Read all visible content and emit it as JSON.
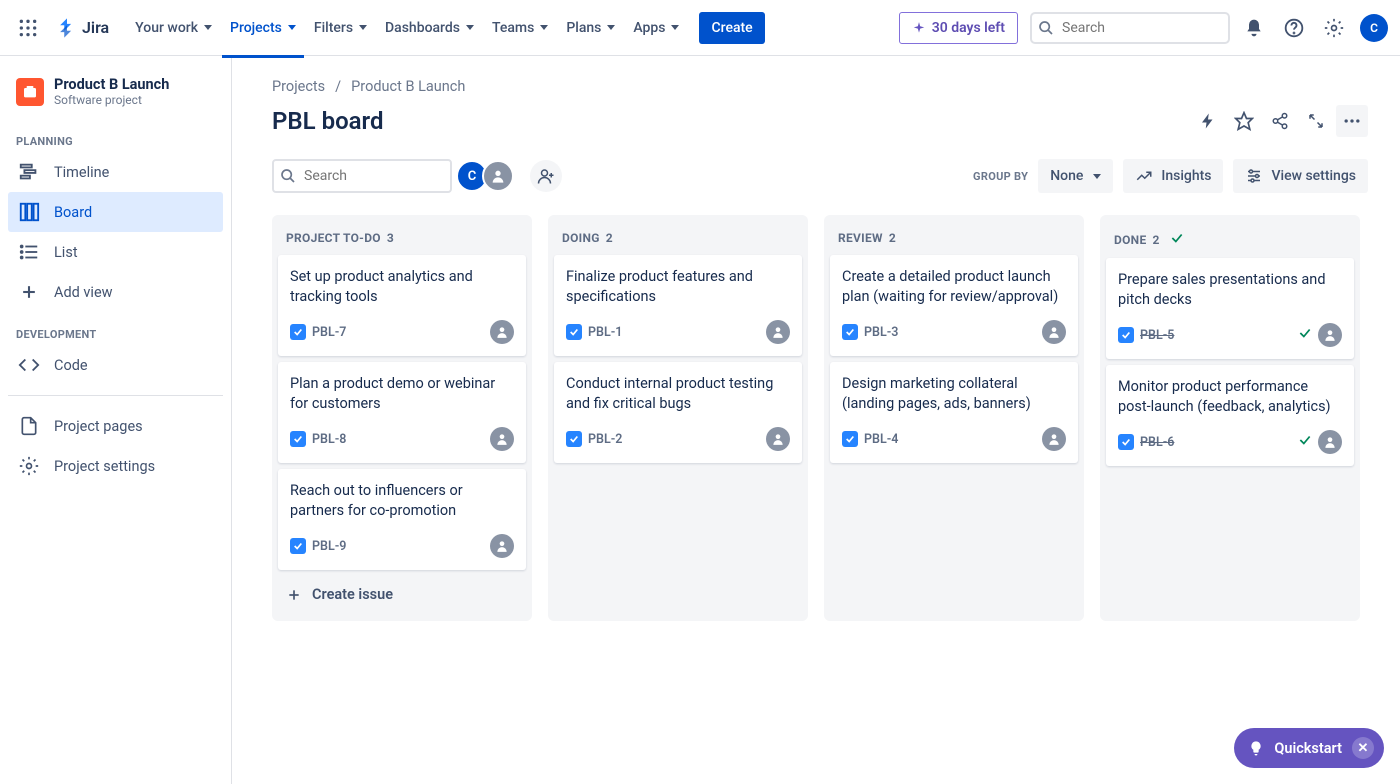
{
  "topnav": {
    "logo": "Jira",
    "items": [
      {
        "label": "Your work",
        "active": false
      },
      {
        "label": "Projects",
        "active": true
      },
      {
        "label": "Filters",
        "active": false
      },
      {
        "label": "Dashboards",
        "active": false
      },
      {
        "label": "Teams",
        "active": false
      },
      {
        "label": "Plans",
        "active": false
      },
      {
        "label": "Apps",
        "active": false
      }
    ],
    "create": "Create",
    "trial": "30 days left",
    "search_placeholder": "Search",
    "avatar_initial": "C"
  },
  "sidebar": {
    "project": {
      "name": "Product B Launch",
      "type": "Software project"
    },
    "sections": {
      "planning": "PLANNING",
      "development": "DEVELOPMENT"
    },
    "items": {
      "timeline": "Timeline",
      "board": "Board",
      "list": "List",
      "add_view": "Add view",
      "code": "Code",
      "project_pages": "Project pages",
      "project_settings": "Project settings"
    }
  },
  "breadcrumb": {
    "root": "Projects",
    "project": "Product B Launch"
  },
  "page": {
    "title": "PBL board",
    "search_placeholder": "Search",
    "group_by_label": "GROUP BY",
    "group_by_value": "None",
    "insights": "Insights",
    "view_settings": "View settings",
    "create_issue": "Create issue",
    "avatar_initial": "C"
  },
  "columns": [
    {
      "name": "PROJECT TO-DO",
      "count": "3",
      "done": false,
      "cards": [
        {
          "title": "Set up product analytics and tracking tools",
          "key": "PBL-7",
          "struck": false,
          "done": false
        },
        {
          "title": "Plan a product demo or webinar for customers",
          "key": "PBL-8",
          "struck": false,
          "done": false
        },
        {
          "title": "Reach out to influencers or partners for co-promotion",
          "key": "PBL-9",
          "struck": false,
          "done": false
        }
      ],
      "show_create": true
    },
    {
      "name": "DOING",
      "count": "2",
      "done": false,
      "cards": [
        {
          "title": "Finalize product features and specifications",
          "key": "PBL-1",
          "struck": false,
          "done": false
        },
        {
          "title": "Conduct internal product testing and fix critical bugs",
          "key": "PBL-2",
          "struck": false,
          "done": false
        }
      ],
      "show_create": false
    },
    {
      "name": "REVIEW",
      "count": "2",
      "done": false,
      "cards": [
        {
          "title": "Create a detailed product launch plan (waiting for review/approval)",
          "key": "PBL-3",
          "struck": false,
          "done": false
        },
        {
          "title": "Design marketing collateral (landing pages, ads, banners)",
          "key": "PBL-4",
          "struck": false,
          "done": false
        }
      ],
      "show_create": false
    },
    {
      "name": "DONE",
      "count": "2",
      "done": true,
      "cards": [
        {
          "title": "Prepare sales presentations and pitch decks",
          "key": "PBL-5",
          "struck": true,
          "done": true
        },
        {
          "title": "Monitor product performance post-launch (feedback, analytics)",
          "key": "PBL-6",
          "struck": true,
          "done": true
        }
      ],
      "show_create": false
    }
  ],
  "quickstart": "Quickstart"
}
